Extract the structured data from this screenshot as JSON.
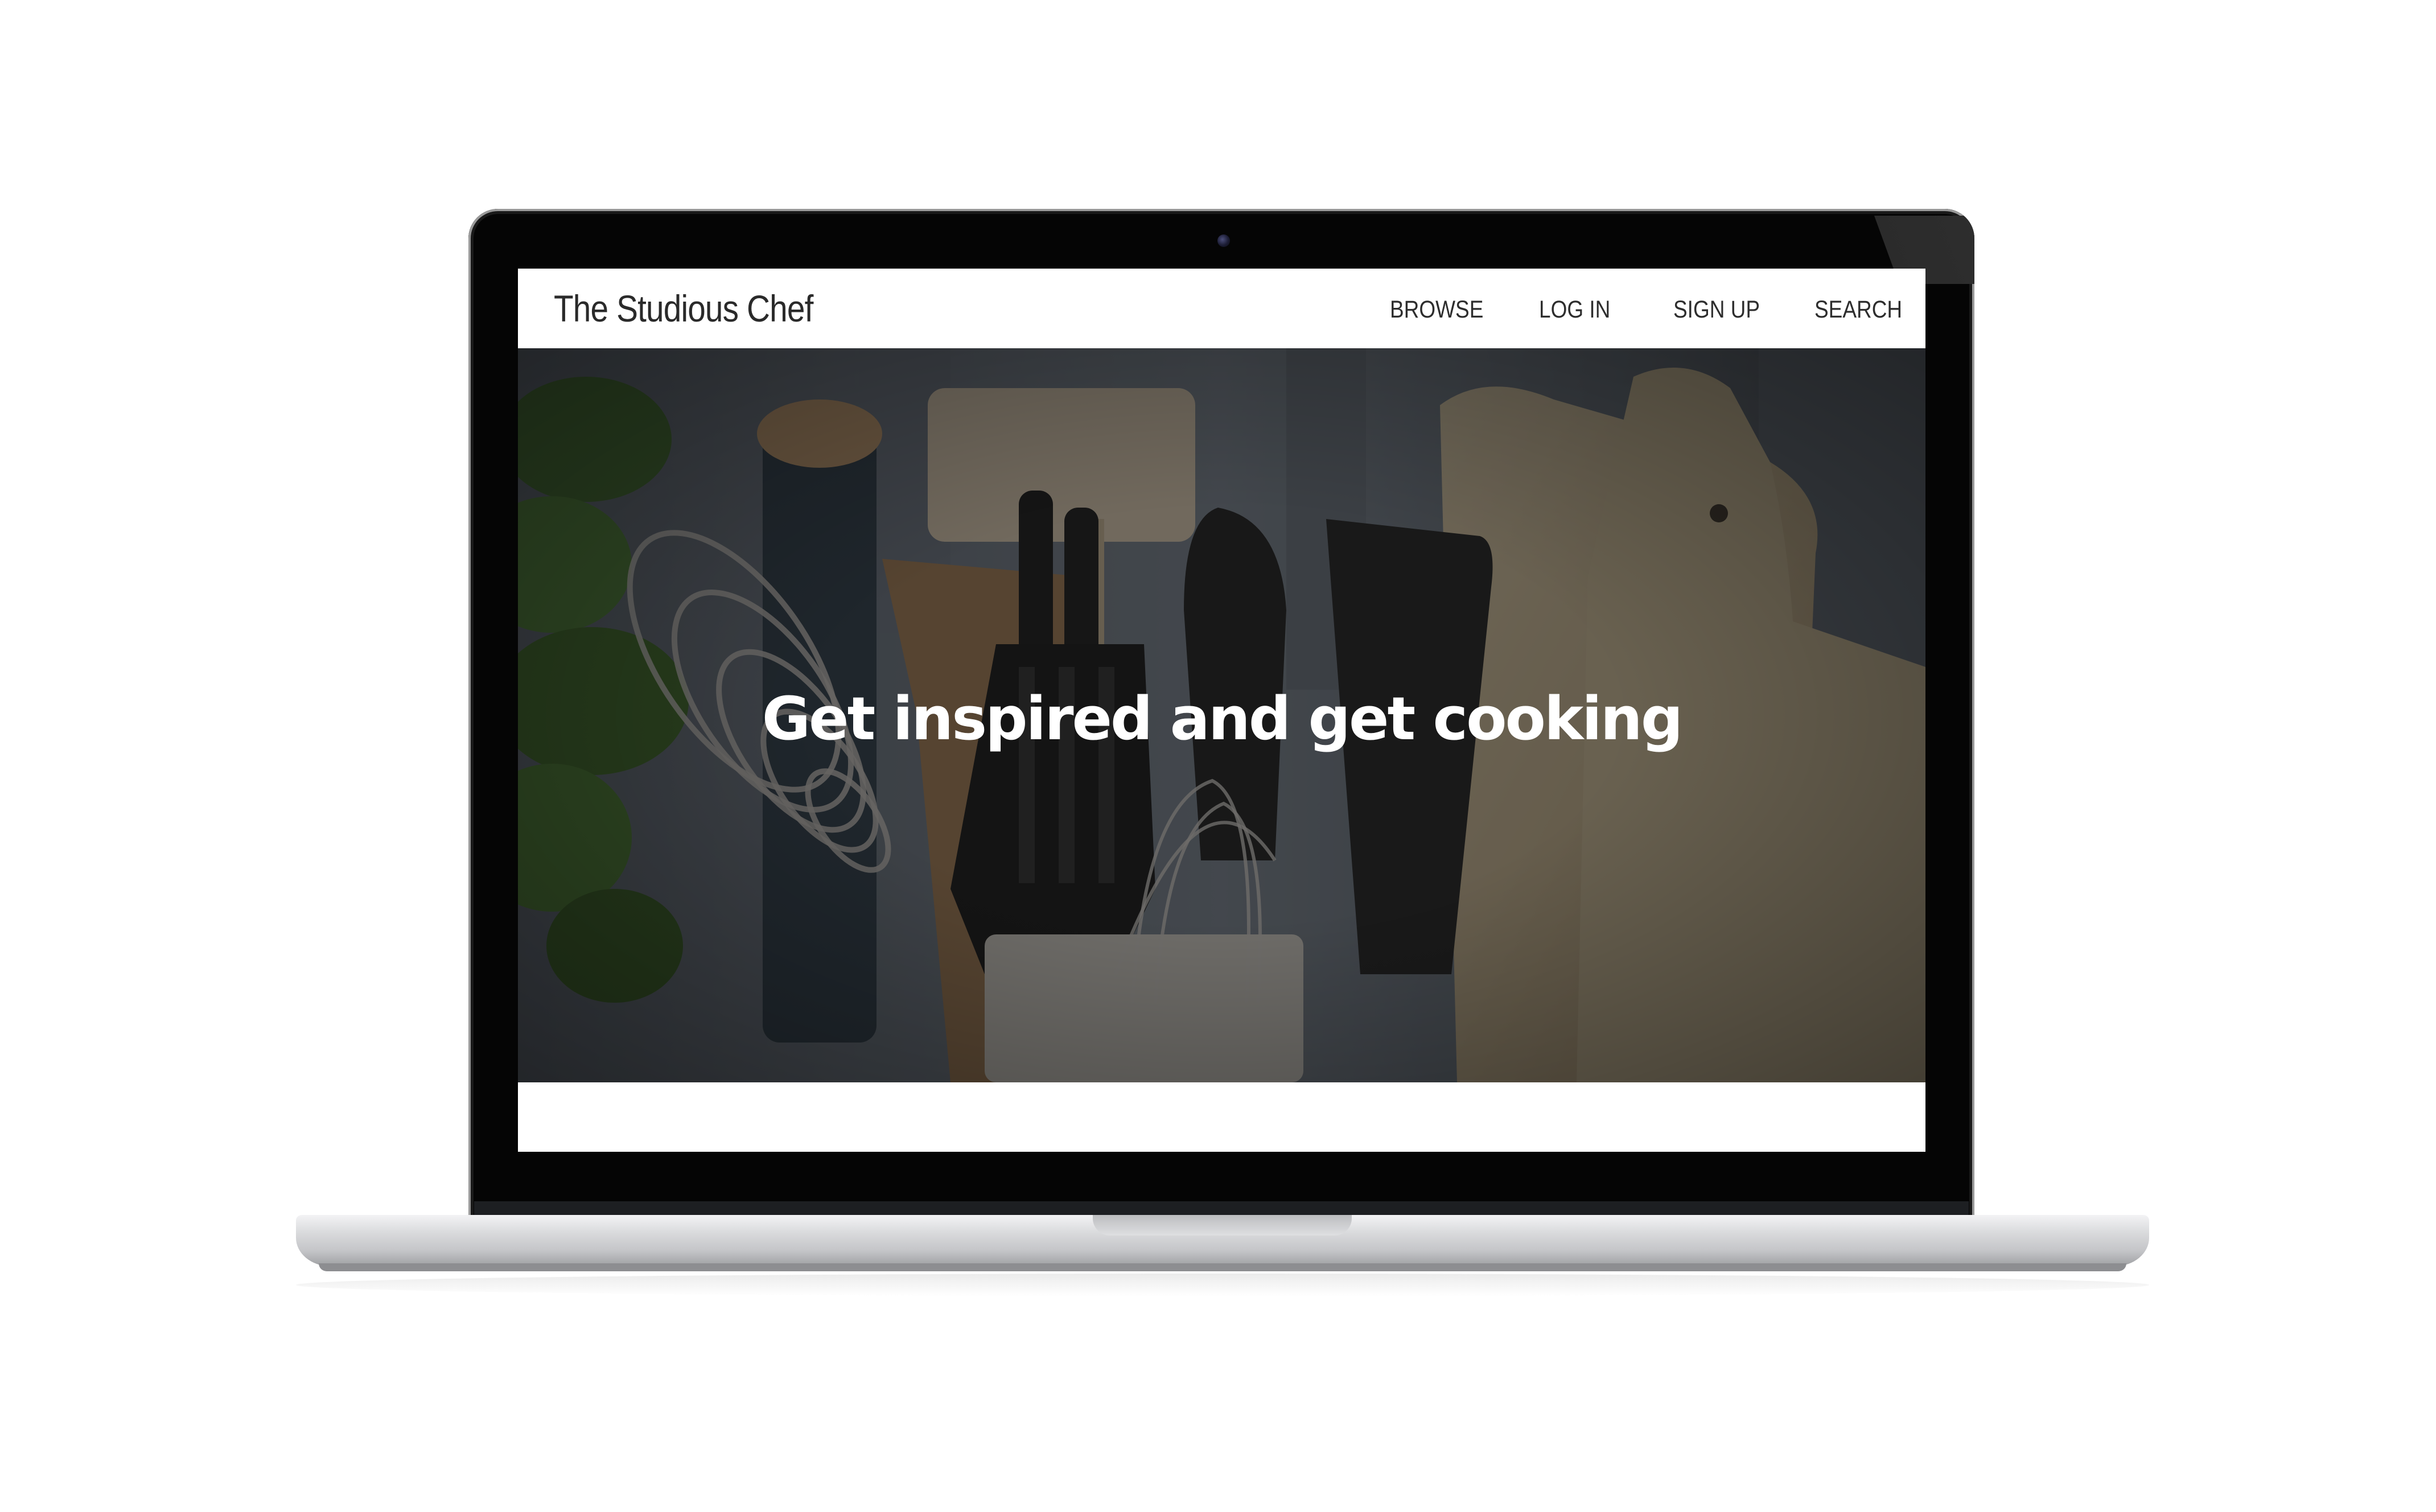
{
  "site": {
    "brand": "The Studious Chef"
  },
  "nav": {
    "items": [
      {
        "label": "BROWSE"
      },
      {
        "label": "LOG IN"
      },
      {
        "label": "SIGN UP"
      },
      {
        "label": "SEARCH"
      }
    ]
  },
  "hero": {
    "title": "Get inspired and get cooking"
  },
  "colors": {
    "hero_overlay": "#1a1a1a",
    "text_light": "#ffffff",
    "text_dark": "#2a2a2a"
  }
}
